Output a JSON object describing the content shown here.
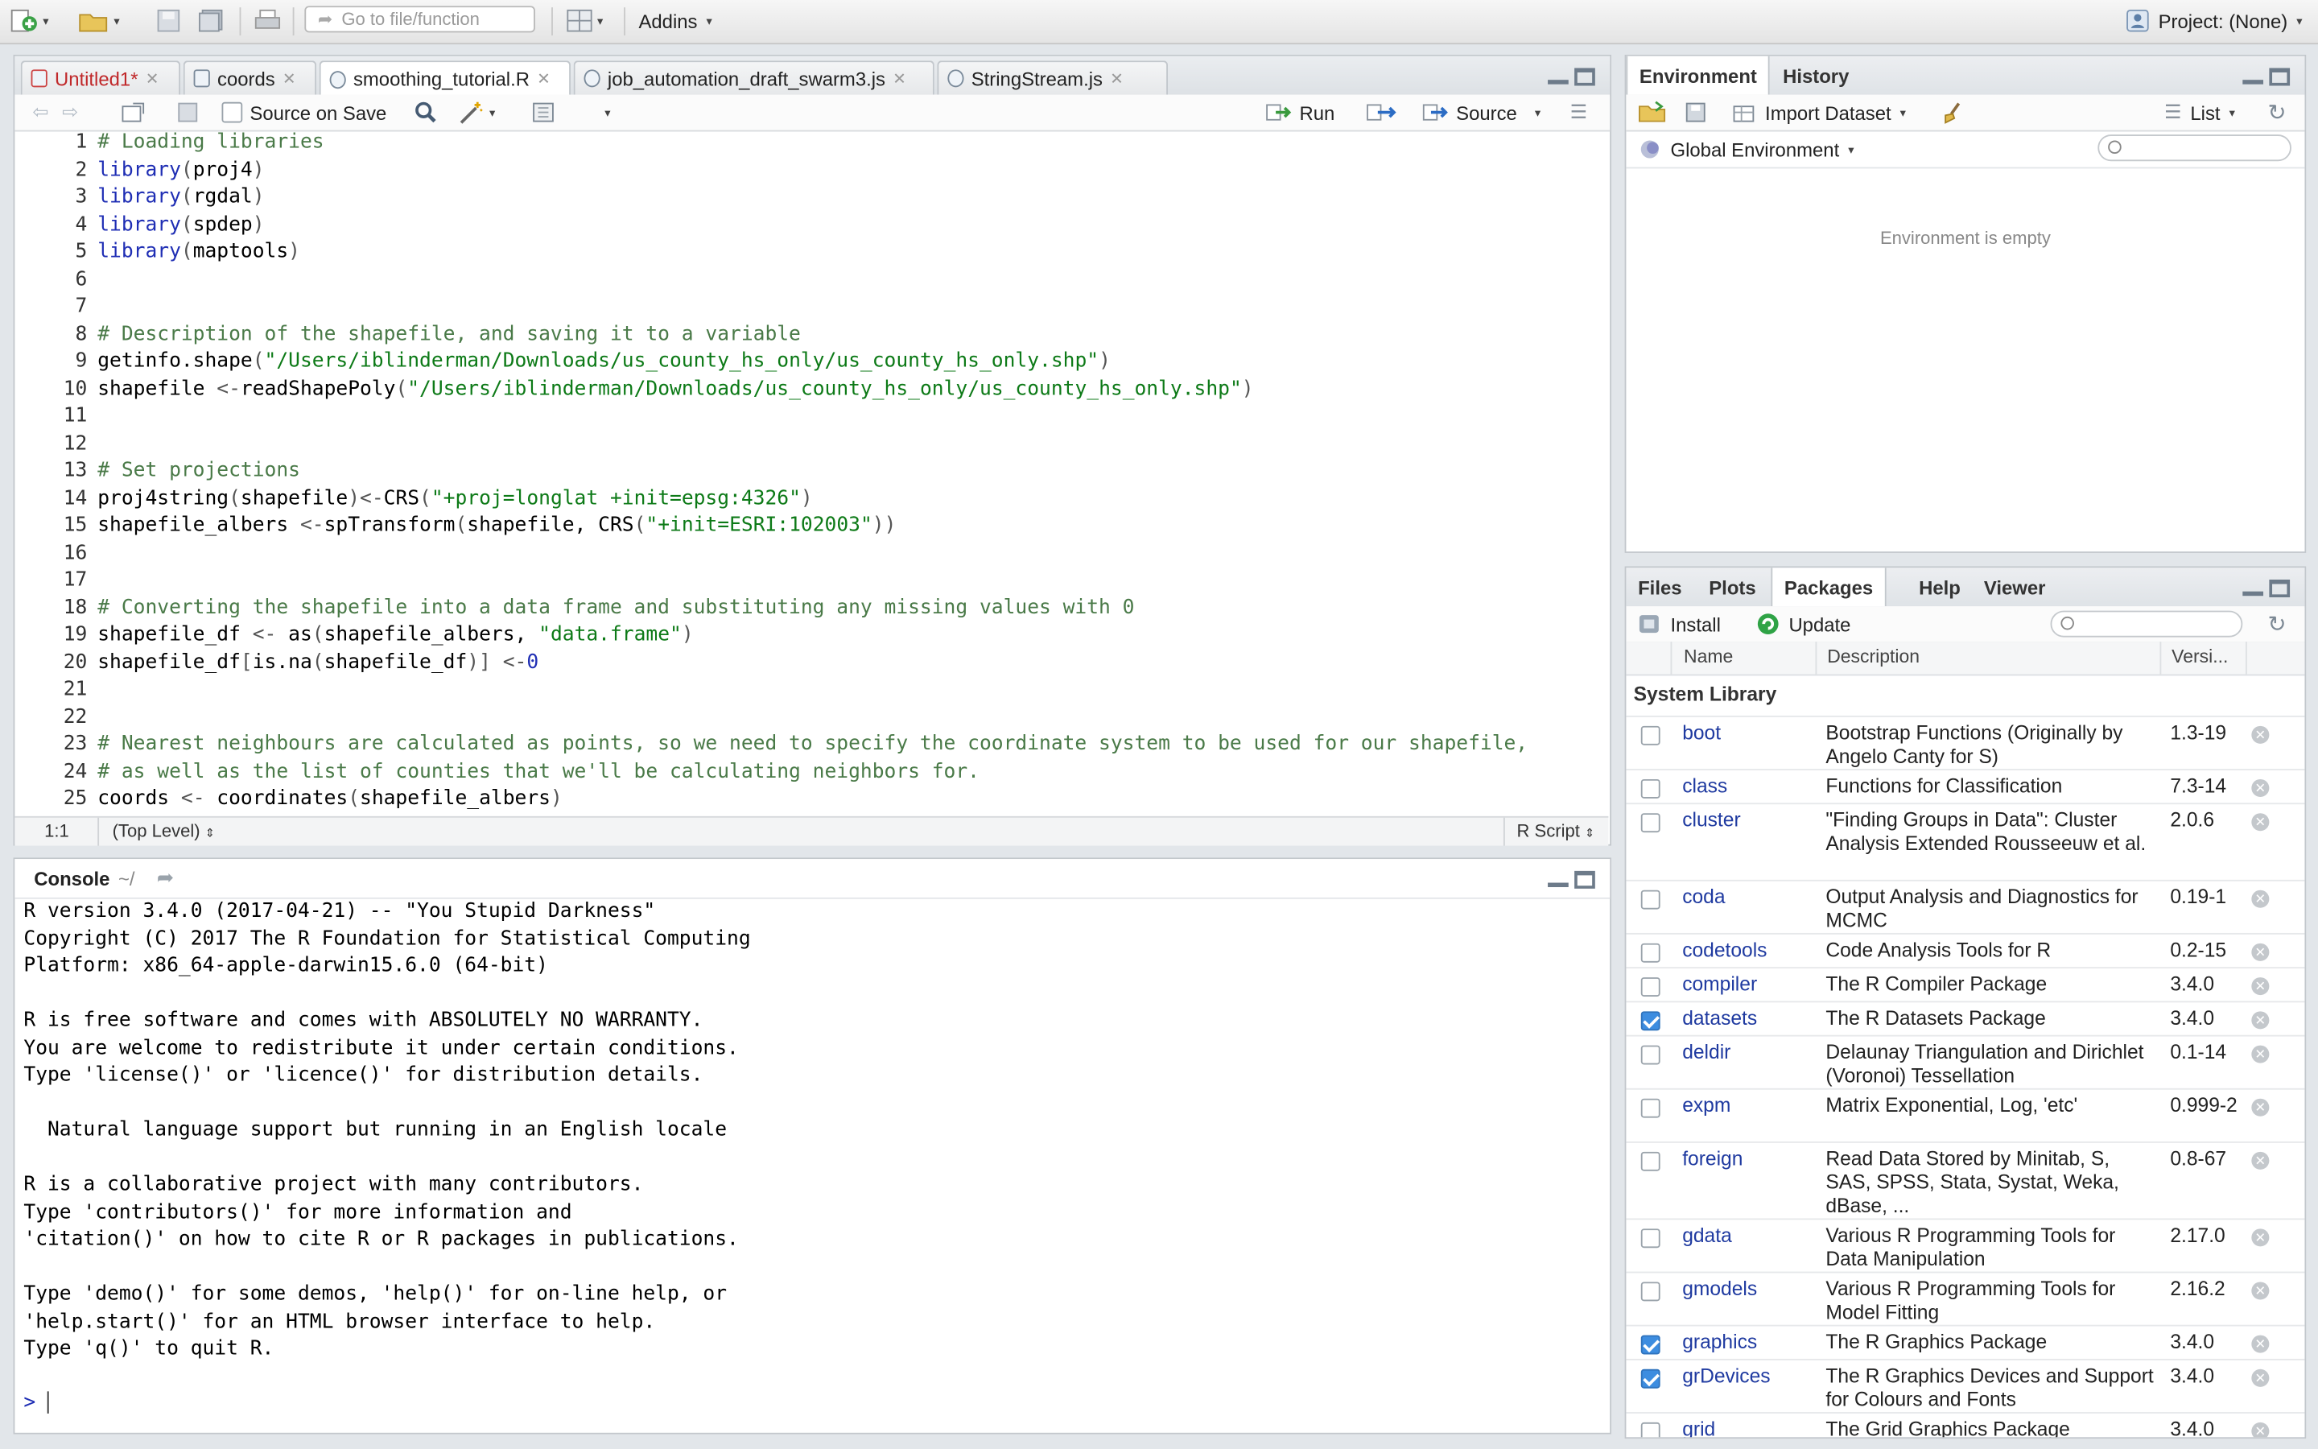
{
  "toolbar": {
    "goto_placeholder": "Go to file/function",
    "addins_label": "Addins",
    "project_label": "Project: (None)"
  },
  "editor": {
    "tabs": [
      {
        "label": "Untitled1*",
        "unsaved": true
      },
      {
        "label": "coords"
      },
      {
        "label": "smoothing_tutorial.R",
        "active": true
      },
      {
        "label": "job_automation_draft_swarm3.js"
      },
      {
        "label": "StringStream.js"
      }
    ],
    "source_on_save_label": "Source on Save",
    "run_label": "Run",
    "source_label": "Source",
    "lines": [
      [
        [
          "cm",
          "# Loading libraries"
        ]
      ],
      [
        [
          "fn",
          "library"
        ],
        [
          "op",
          "("
        ],
        [
          "tx",
          "proj4"
        ],
        [
          "op",
          ")"
        ]
      ],
      [
        [
          "fn",
          "library"
        ],
        [
          "op",
          "("
        ],
        [
          "tx",
          "rgdal"
        ],
        [
          "op",
          ")"
        ]
      ],
      [
        [
          "fn",
          "library"
        ],
        [
          "op",
          "("
        ],
        [
          "tx",
          "spdep"
        ],
        [
          "op",
          ")"
        ]
      ],
      [
        [
          "fn",
          "library"
        ],
        [
          "op",
          "("
        ],
        [
          "tx",
          "maptools"
        ],
        [
          "op",
          ")"
        ]
      ],
      [],
      [],
      [
        [
          "cm",
          "# Description of the shapefile, and saving it to a variable"
        ]
      ],
      [
        [
          "tx",
          "getinfo.shape"
        ],
        [
          "op",
          "("
        ],
        [
          "st",
          "\"/Users/iblinderman/Downloads/us_county_hs_only/us_county_hs_only.shp\""
        ],
        [
          "op",
          ")"
        ]
      ],
      [
        [
          "tx",
          "shapefile "
        ],
        [
          "op",
          "<-"
        ],
        [
          "tx",
          "readShapePoly"
        ],
        [
          "op",
          "("
        ],
        [
          "st",
          "\"/Users/iblinderman/Downloads/us_county_hs_only/us_county_hs_only.shp\""
        ],
        [
          "op",
          ")"
        ]
      ],
      [],
      [],
      [
        [
          "cm",
          "# Set projections"
        ]
      ],
      [
        [
          "tx",
          "proj4string"
        ],
        [
          "op",
          "("
        ],
        [
          "tx",
          "shapefile"
        ],
        [
          "op",
          ")<-"
        ],
        [
          "tx",
          "CRS"
        ],
        [
          "op",
          "("
        ],
        [
          "st",
          "\"+proj=longlat +init=epsg:4326\""
        ],
        [
          "op",
          ")"
        ]
      ],
      [
        [
          "tx",
          "shapefile_albers "
        ],
        [
          "op",
          "<-"
        ],
        [
          "tx",
          "spTransform"
        ],
        [
          "op",
          "("
        ],
        [
          "tx",
          "shapefile, CRS"
        ],
        [
          "op",
          "("
        ],
        [
          "st",
          "\"+init=ESRI:102003\""
        ],
        [
          "op",
          "))"
        ]
      ],
      [],
      [],
      [
        [
          "cm",
          "# Converting the shapefile into a data frame and substituting any missing values with 0"
        ]
      ],
      [
        [
          "tx",
          "shapefile_df "
        ],
        [
          "op",
          "<-"
        ],
        [
          "tx",
          " as"
        ],
        [
          "op",
          "("
        ],
        [
          "tx",
          "shapefile_albers, "
        ],
        [
          "st",
          "\"data.frame\""
        ],
        [
          "op",
          ")"
        ]
      ],
      [
        [
          "tx",
          "shapefile_df"
        ],
        [
          "op",
          "["
        ],
        [
          "tx",
          "is.na"
        ],
        [
          "op",
          "("
        ],
        [
          "tx",
          "shapefile_df"
        ],
        [
          "op",
          ")]"
        ],
        [
          "tx",
          " "
        ],
        [
          "op",
          "<-"
        ],
        [
          "fn",
          "0"
        ]
      ],
      [],
      [],
      [
        [
          "cm",
          "# Nearest neighbours are calculated as points, so we need to specify the coordinate system to be used for our shapefile,"
        ]
      ],
      [
        [
          "cm",
          "# as well as the list of counties that we'll be calculating neighbors for."
        ]
      ],
      [
        [
          "tx",
          "coords "
        ],
        [
          "op",
          "<-"
        ],
        [
          "tx",
          " coordinates"
        ],
        [
          "op",
          "("
        ],
        [
          "tx",
          "shapefile_albers"
        ],
        [
          "op",
          ")"
        ]
      ]
    ],
    "status": {
      "position": "1:1",
      "scope": "(Top Level)",
      "filetype": "R Script"
    }
  },
  "console": {
    "title": "Console",
    "path": "~/",
    "output": "R version 3.4.0 (2017-04-21) -- \"You Stupid Darkness\"\nCopyright (C) 2017 The R Foundation for Statistical Computing\nPlatform: x86_64-apple-darwin15.6.0 (64-bit)\n\nR is free software and comes with ABSOLUTELY NO WARRANTY.\nYou are welcome to redistribute it under certain conditions.\nType 'license()' or 'licence()' for distribution details.\n\n  Natural language support but running in an English locale\n\nR is a collaborative project with many contributors.\nType 'contributors()' for more information and\n'citation()' on how to cite R or R packages in publications.\n\nType 'demo()' for some demos, 'help()' for on-line help, or\n'help.start()' for an HTML browser interface to help.\nType 'q()' to quit R.",
    "prompt": ">"
  },
  "env": {
    "tabs": [
      "Environment",
      "History"
    ],
    "import_label": "Import Dataset",
    "list_label": "List",
    "global_env_label": "Global Environment",
    "empty_text": "Environment is empty"
  },
  "files_pane": {
    "tabs": [
      "Files",
      "Plots",
      "Packages",
      "Help",
      "Viewer"
    ],
    "install_label": "Install",
    "update_label": "Update",
    "col_name": "Name",
    "col_desc": "Description",
    "col_ver": "Versi...",
    "system_library_label": "System Library",
    "packages": [
      {
        "name": "boot",
        "desc": "Bootstrap Functions (Originally by Angelo Canty for S)",
        "ver": "1.3-19",
        "checked": false,
        "lines": 2
      },
      {
        "name": "class",
        "desc": "Functions for Classification",
        "ver": "7.3-14",
        "checked": false,
        "lines": 1
      },
      {
        "name": "cluster",
        "desc": "\"Finding Groups in Data\": Cluster Analysis Extended Rousseeuw et al.",
        "ver": "2.0.6",
        "checked": false,
        "lines": 3
      },
      {
        "name": "coda",
        "desc": "Output Analysis and Diagnostics for MCMC",
        "ver": "0.19-1",
        "checked": false,
        "lines": 2
      },
      {
        "name": "codetools",
        "desc": "Code Analysis Tools for R",
        "ver": "0.2-15",
        "checked": false,
        "lines": 1
      },
      {
        "name": "compiler",
        "desc": "The R Compiler Package",
        "ver": "3.4.0",
        "checked": false,
        "lines": 1
      },
      {
        "name": "datasets",
        "desc": "The R Datasets Package",
        "ver": "3.4.0",
        "checked": true,
        "lines": 1
      },
      {
        "name": "deldir",
        "desc": "Delaunay Triangulation and Dirichlet (Voronoi) Tessellation",
        "ver": "0.1-14",
        "checked": false,
        "lines": 2
      },
      {
        "name": "expm",
        "desc": "Matrix Exponential, Log, 'etc'",
        "ver": "0.999-2",
        "checked": false,
        "lines": 2
      },
      {
        "name": "foreign",
        "desc": "Read Data Stored by Minitab, S, SAS, SPSS, Stata, Systat, Weka, dBase, ...",
        "ver": "0.8-67",
        "checked": false,
        "lines": 3
      },
      {
        "name": "gdata",
        "desc": "Various R Programming Tools for Data Manipulation",
        "ver": "2.17.0",
        "checked": false,
        "lines": 2
      },
      {
        "name": "gmodels",
        "desc": "Various R Programming Tools for Model Fitting",
        "ver": "2.16.2",
        "checked": false,
        "lines": 2
      },
      {
        "name": "graphics",
        "desc": "The R Graphics Package",
        "ver": "3.4.0",
        "checked": true,
        "lines": 1
      },
      {
        "name": "grDevices",
        "desc": "The R Graphics Devices and Support for Colours and Fonts",
        "ver": "3.4.0",
        "checked": true,
        "lines": 2
      },
      {
        "name": "grid",
        "desc": "The Grid Graphics Package",
        "ver": "3.4.0",
        "checked": false,
        "lines": 1
      }
    ]
  }
}
